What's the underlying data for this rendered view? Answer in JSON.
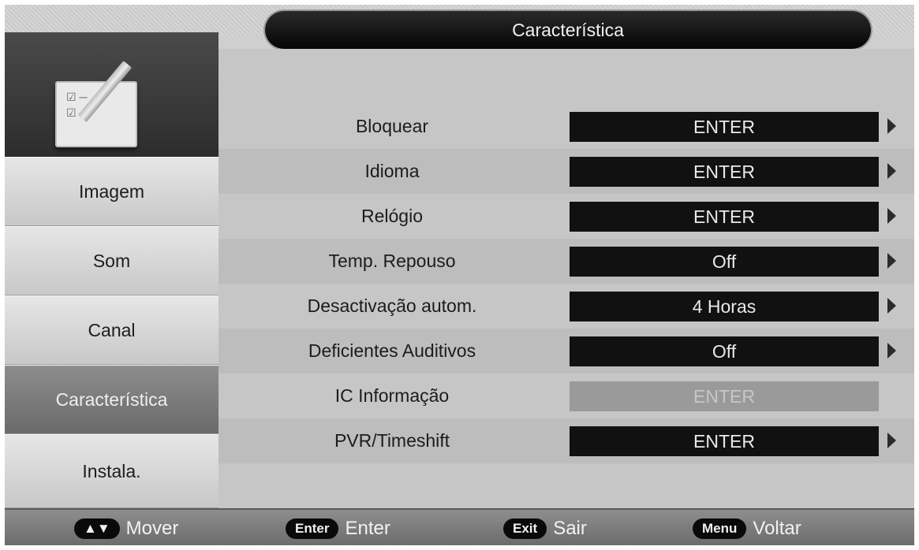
{
  "header": {
    "title": "Característica"
  },
  "sidebar": {
    "items": [
      {
        "label": "Imagem",
        "active": false
      },
      {
        "label": "Som",
        "active": false
      },
      {
        "label": "Canal",
        "active": false
      },
      {
        "label": "Característica",
        "active": true
      },
      {
        "label": "Instala.",
        "active": false
      }
    ]
  },
  "menu": {
    "rows": [
      {
        "label": "Bloquear",
        "value": "ENTER",
        "enabled": true
      },
      {
        "label": "Idioma",
        "value": "ENTER",
        "enabled": true
      },
      {
        "label": "Relógio",
        "value": "ENTER",
        "enabled": true
      },
      {
        "label": "Temp. Repouso",
        "value": "Off",
        "enabled": true
      },
      {
        "label": "Desactivação autom.",
        "value": "4 Horas",
        "enabled": true
      },
      {
        "label": "Deficientes Auditivos",
        "value": "Off",
        "enabled": true
      },
      {
        "label": "IC Informação",
        "value": "ENTER",
        "enabled": false
      },
      {
        "label": "PVR/Timeshift",
        "value": "ENTER",
        "enabled": true
      }
    ]
  },
  "footer": {
    "hints": [
      {
        "key": "▲▼",
        "text": "Mover"
      },
      {
        "key": "Enter",
        "text": "Enter"
      },
      {
        "key": "Exit",
        "text": "Sair"
      },
      {
        "key": "Menu",
        "text": "Voltar"
      }
    ]
  }
}
